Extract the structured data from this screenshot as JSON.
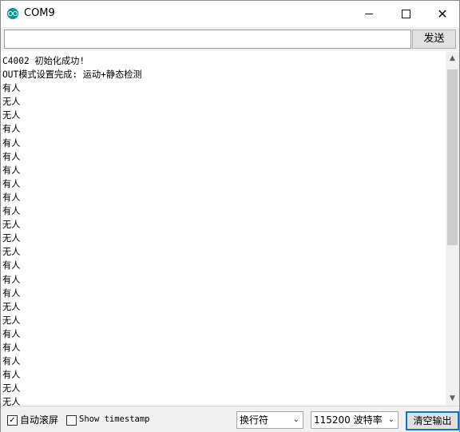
{
  "window": {
    "title": "COM9",
    "minimize": "—",
    "maximize": "☐",
    "close": "✕"
  },
  "input": {
    "value": "",
    "send_label": "发送"
  },
  "output_lines": [
    "C4002 初始化成功!",
    "OUT模式设置完成: 运动+静态检测",
    "有人",
    "无人",
    "无人",
    "有人",
    "有人",
    "有人",
    "有人",
    "有人",
    "有人",
    "有人",
    "无人",
    "无人",
    "无人",
    "有人",
    "有人",
    "有人",
    "无人",
    "无人",
    "有人",
    "有人",
    "有人",
    "有人",
    "无人",
    "无人"
  ],
  "scroll": {
    "up_icon": "▲",
    "down_icon": "▼"
  },
  "footer": {
    "autoscroll_label": "自动滚屏",
    "autoscroll_checked": "✓",
    "timestamp_label": "Show timestamp",
    "line_ending": "换行符",
    "baud_rate": "115200 波特率",
    "clear_label": "清空输出",
    "dropdown_icon": "⌄"
  }
}
